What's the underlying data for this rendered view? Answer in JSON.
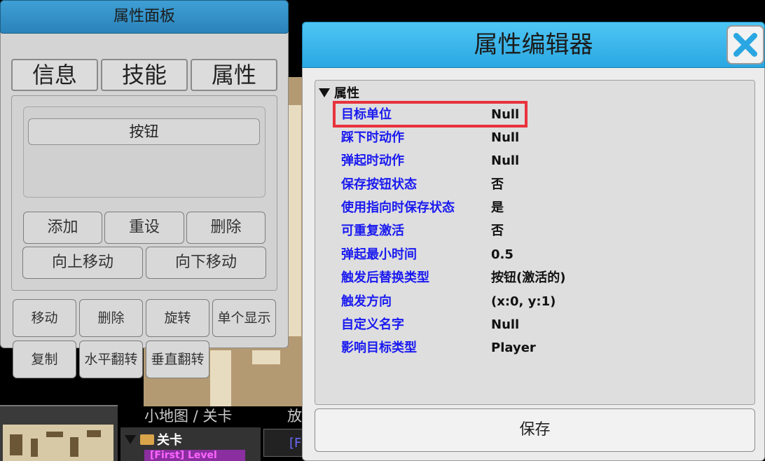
{
  "left_panel": {
    "title": "属性面板",
    "tabs": [
      "信息",
      "技能",
      "属性"
    ],
    "list_item": "按钮",
    "buttons": {
      "add": "添加",
      "reset": "重设",
      "delete": "删除",
      "move_up": "向上移动",
      "move_down": "向下移动"
    },
    "tools": {
      "move": "移动",
      "delete": "删除",
      "rotate": "旋转",
      "single_display": "单个显示",
      "copy": "复制",
      "flip_h": "水平翻转",
      "flip_v": "垂直翻转"
    }
  },
  "editor": {
    "title": "属性编辑器",
    "close_icon": "close-icon",
    "group": "属性",
    "rows": [
      {
        "name": "目标单位",
        "value": "Null",
        "highlighted": true
      },
      {
        "name": "踩下时动作",
        "value": "Null"
      },
      {
        "name": "弹起时动作",
        "value": "Null"
      },
      {
        "name": "保存按钮状态",
        "value": "否"
      },
      {
        "name": "使用指向时保存状态",
        "value": "是"
      },
      {
        "name": "可重复激活",
        "value": "否"
      },
      {
        "name": "弹起最小时间",
        "value": "0.5"
      },
      {
        "name": "触发后替换类型",
        "value": "按钮(激活的)"
      },
      {
        "name": "触发方向",
        "value": "(x:0, y:1)"
      },
      {
        "name": "自定义名字",
        "value": "Null"
      },
      {
        "name": "影响目标类型",
        "value": "Player"
      }
    ],
    "save": "保存",
    "highlight_color": "#e8333c"
  },
  "background": {
    "minimap_label": "小地图 / 关卡",
    "partial_label": "放",
    "tree_item": "关卡",
    "level_tag": "[First] Level",
    "field_prefix": "[F"
  }
}
